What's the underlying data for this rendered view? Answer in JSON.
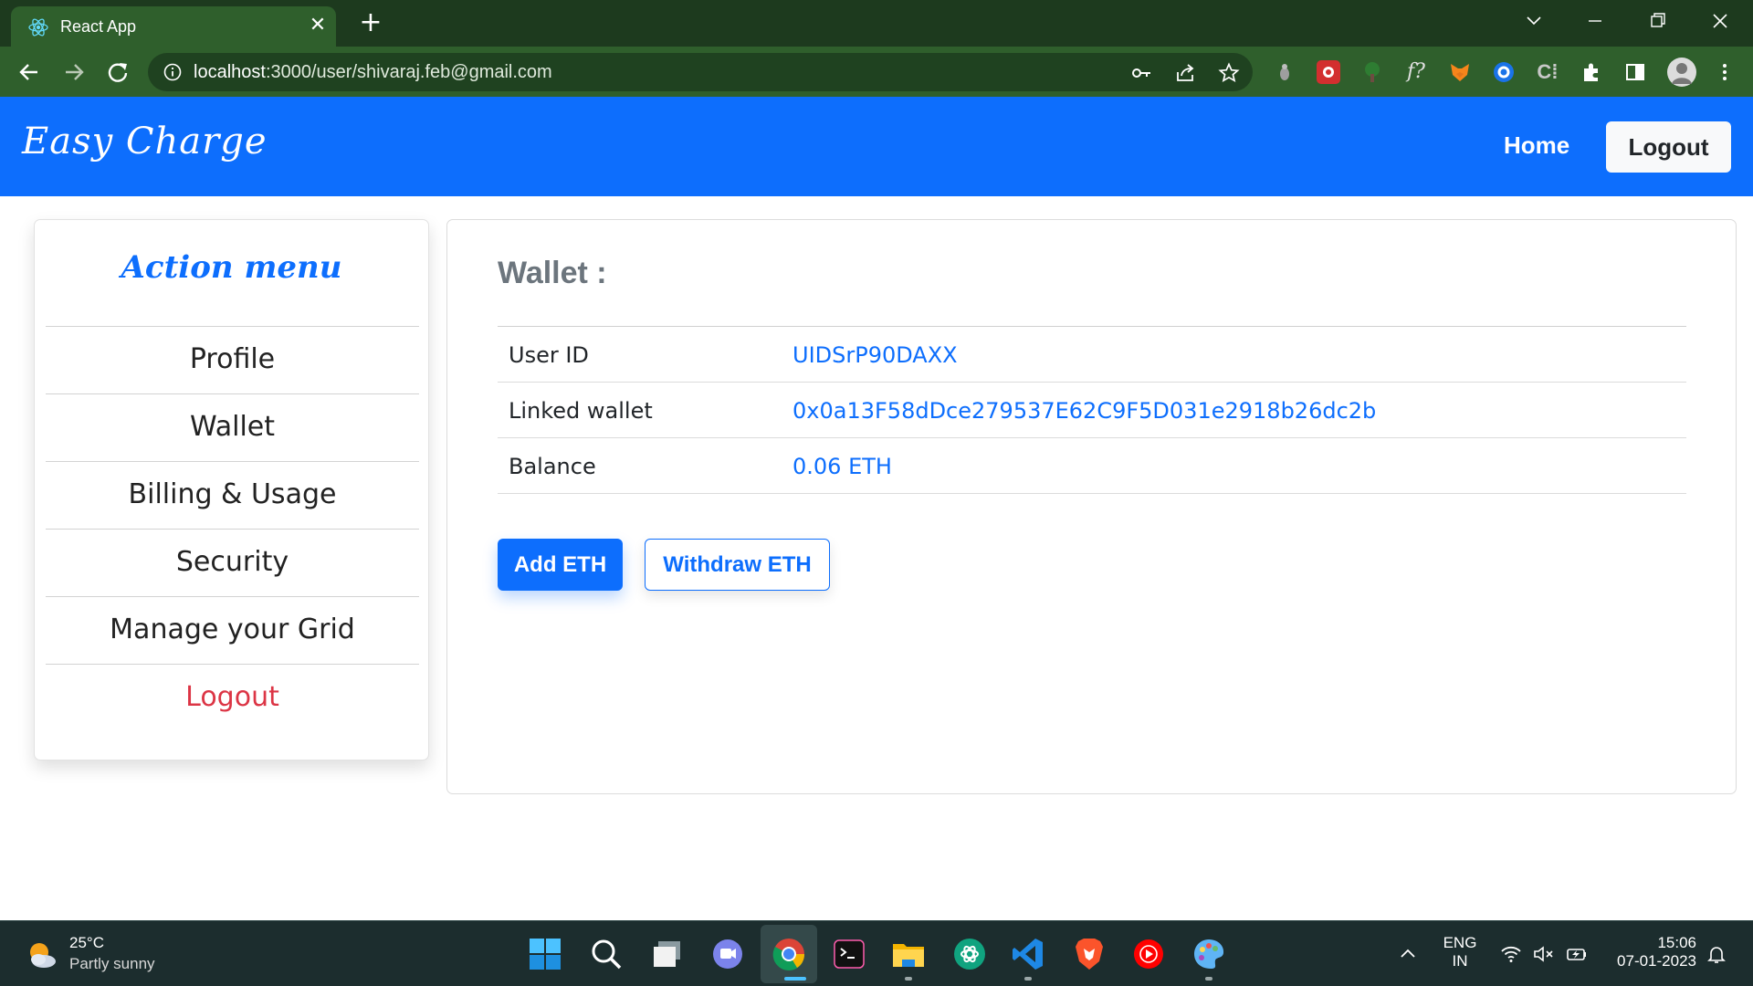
{
  "browser": {
    "tab_title": "React App",
    "url_host": "localhost",
    "url_path": ":3000/user/shivaraj.feb@gmail.com"
  },
  "navbar": {
    "brand": "Easy Charge",
    "home_label": "Home",
    "logout_label": "Logout"
  },
  "sidebar": {
    "title": "Action menu",
    "items": [
      {
        "label": "Profile"
      },
      {
        "label": "Wallet"
      },
      {
        "label": "Billing & Usage"
      },
      {
        "label": "Security"
      },
      {
        "label": "Manage your Grid"
      },
      {
        "label": "Logout"
      }
    ]
  },
  "wallet": {
    "title": "Wallet :",
    "rows": [
      {
        "label": "User ID",
        "value": "UIDSrP90DAXX"
      },
      {
        "label": "Linked wallet",
        "value": "0x0a13F58dDce279537E62C9F5D031e2918b26dc2b"
      },
      {
        "label": "Balance",
        "value": "0.06 ETH"
      }
    ],
    "add_button": "Add ETH",
    "withdraw_button": "Withdraw ETH"
  },
  "taskbar": {
    "weather_temp": "25°C",
    "weather_desc": "Partly sunny",
    "lang_line1": "ENG",
    "lang_line2": "IN",
    "time": "15:06",
    "date": "07-01-2023"
  },
  "colors": {
    "primary": "#0d6efd",
    "danger": "#dc3545",
    "chrome_frame": "#1d3a1e",
    "chrome_toolbar": "#2f5f2c",
    "taskbar": "#1c2d2e"
  }
}
